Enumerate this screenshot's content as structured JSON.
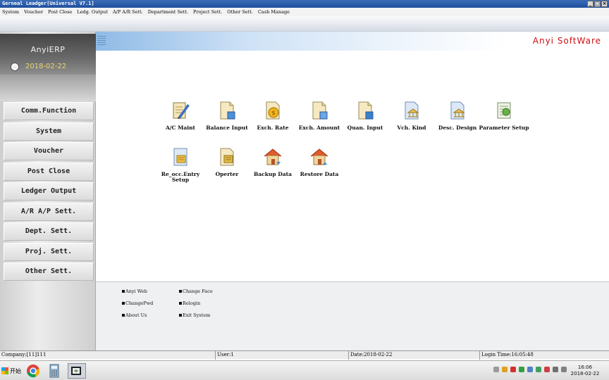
{
  "window": {
    "title": "Gerneal Leadger[Universal V7.1]",
    "buttons": [
      "_",
      "□",
      "×"
    ]
  },
  "menu": [
    "System",
    "Voucher",
    "Post Close",
    "Ledg. Output",
    "A/P A/R Sett.",
    "Department Sett.",
    "Project Sett.",
    "Other Sett.",
    "Cash Manage"
  ],
  "sidebar": {
    "logo": "AnyiERP",
    "date": "2018-02-22",
    "nav": [
      "Comm.Function",
      "System",
      "Voucher",
      "Post Close",
      "Ledger Output",
      "A/R A/P Sett.",
      "Dept. Sett.",
      "Proj. Sett.",
      "Other Sett."
    ]
  },
  "brand": "Anyi SoftWare",
  "functions": [
    {
      "label": "A/C Maint",
      "icon": "pencil-ledger-icon"
    },
    {
      "label": "Balance Input",
      "icon": "document-input-icon"
    },
    {
      "label": "Exch. Rate",
      "icon": "coin-document-icon"
    },
    {
      "label": "Exch. Amount",
      "icon": "document-amount-icon"
    },
    {
      "label": "Quan. Input",
      "icon": "document-quantity-icon"
    },
    {
      "label": "Vch. Kind",
      "icon": "voucher-kind-icon"
    },
    {
      "label": "Desc. Design",
      "icon": "description-design-icon"
    },
    {
      "label": "Parameter Setup",
      "icon": "parameter-setup-icon"
    },
    {
      "label": "Re_occ.Entry Setup",
      "icon": "recurring-entry-icon"
    },
    {
      "label": "Operter",
      "icon": "operator-icon"
    },
    {
      "label": "Backup Data",
      "icon": "house-backup-icon"
    },
    {
      "label": "Restore Data",
      "icon": "house-restore-icon"
    }
  ],
  "links": [
    "Anyi Web",
    "Change Face",
    "ChangePwd",
    "Relogin",
    "About Us",
    "Exit System"
  ],
  "status": {
    "company": "Company:[11]111",
    "user": "User:1",
    "date": "Date:2018-02-22",
    "login": "Login Time:16:05:48"
  },
  "taskbar": {
    "start": "开始",
    "time": "16:06",
    "date": "2018-02-22"
  }
}
